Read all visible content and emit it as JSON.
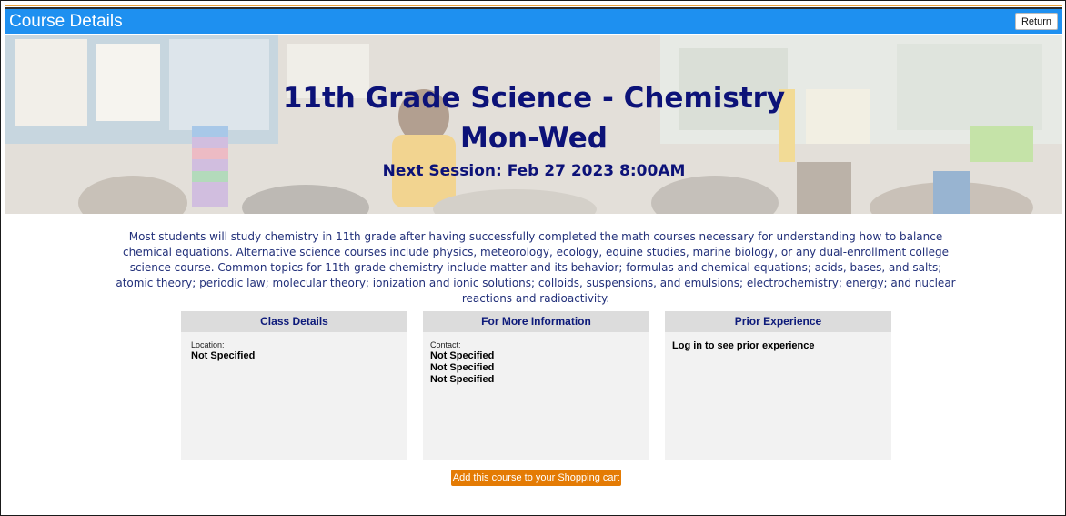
{
  "header": {
    "title": "Course Details",
    "return_label": "Return"
  },
  "hero": {
    "title": "11th Grade Science - Chemistry",
    "subtitle": "Mon-Wed",
    "next_session": "Next Session: Feb 27 2023 8:00AM"
  },
  "description": "Most students will study chemistry in 11th grade after having successfully completed the math courses necessary for understanding how to balance chemical equations. Alternative science courses include physics, meteorology, ecology, equine studies, marine biology, or any dual-enrollment college science course. Common topics for 11th-grade chemistry include matter and its behavior; formulas and chemical equations; acids, bases, and salts; atomic theory; periodic law; molecular theory; ionization and ionic solutions; colloids, suspensions, and emulsions; electrochemistry; energy; and nuclear reactions and radioactivity.",
  "panels": {
    "class_details": {
      "heading": "Class Details",
      "location_label": "Location:",
      "location_value": "Not Specified"
    },
    "more_info": {
      "heading": "For More Information",
      "contact_label": "Contact:",
      "contact_values": [
        "Not Specified",
        "Not Specified",
        "Not Specified"
      ]
    },
    "prior_experience": {
      "heading": "Prior Experience",
      "message": "Log in to see prior experience"
    }
  },
  "cart_button_label": "Add this course to your Shopping cart",
  "colors": {
    "header_blue": "#1e90f0",
    "title_navy": "#0c1278",
    "button_orange": "#e47b04"
  }
}
